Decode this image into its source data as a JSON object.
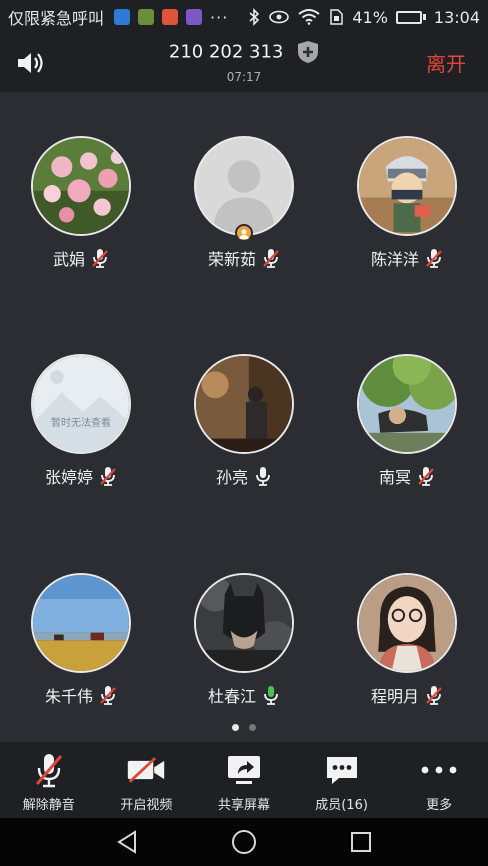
{
  "status_bar": {
    "carrier": "仅限紧急呼叫",
    "app_icon_colors": [
      "#2f7ad8",
      "#6a8f3a",
      "#e0553a",
      "#7b59c9"
    ],
    "overflow": "···",
    "battery_percent": "41%",
    "battery_level": 0.41,
    "time": "13:04"
  },
  "header": {
    "meeting_id": "210 202 313",
    "elapsed": "07:17",
    "leave_label": "离开"
  },
  "participants": [
    {
      "name": "武娟",
      "muted": true,
      "host": false,
      "avatar": "roses-photo"
    },
    {
      "name": "荣新茹",
      "muted": true,
      "host": true,
      "avatar": "default-person"
    },
    {
      "name": "陈洋洋",
      "muted": true,
      "host": false,
      "avatar": "anime-character-photo"
    },
    {
      "name": "张婷婷",
      "muted": true,
      "host": false,
      "avatar": "unavailable-placeholder",
      "avatar_caption": "暂时无法查看"
    },
    {
      "name": "孙亮",
      "muted": false,
      "speaking": false,
      "host": false,
      "avatar": "dark-photo"
    },
    {
      "name": "南冥",
      "muted": true,
      "host": false,
      "avatar": "tree-photo"
    },
    {
      "name": "朱千伟",
      "muted": true,
      "host": false,
      "avatar": "landscape-photo"
    },
    {
      "name": "杜春江",
      "muted": false,
      "speaking": true,
      "host": false,
      "avatar": "batman-photo"
    },
    {
      "name": "程明月",
      "muted": true,
      "host": false,
      "avatar": "woman-glasses-photo"
    }
  ],
  "pager": {
    "pages": 2,
    "current": 1
  },
  "toolbar": {
    "unmute": "解除静音",
    "start_video": "开启视频",
    "share_screen": "共享屏幕",
    "members": "成员(16)",
    "more": "更多"
  },
  "colors": {
    "background": "#2b2d33",
    "bar": "#1f2024",
    "leave": "#e0463a",
    "muted_slash": "#e0463a",
    "speaking": "#4cc24a",
    "host_badge": "#f2a33a"
  }
}
